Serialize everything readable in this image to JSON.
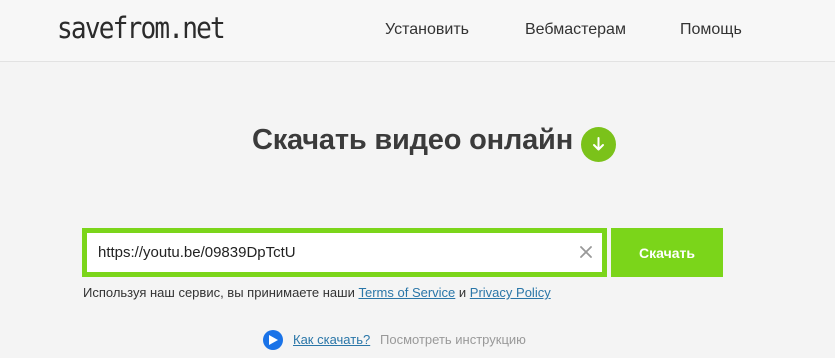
{
  "header": {
    "logo": "savefrom.net",
    "nav": [
      "Установить",
      "Вебмастерам",
      "Помощь"
    ]
  },
  "hero": {
    "title": "Скачать видео онлайн",
    "icon": "download-arrow-icon"
  },
  "form": {
    "url_value": "https://youtu.be/09839DpTctU",
    "submit_label": "Скачать",
    "clear_icon": "close-icon"
  },
  "terms": {
    "prefix": "Используя наш сервис, вы принимаете наши ",
    "tos_label": "Terms of Service",
    "and": " и ",
    "privacy_label": "Privacy Policy"
  },
  "howto": {
    "link_label": "Как скачать?",
    "hint": "Посмотреть инструкцию",
    "icon": "play-icon"
  },
  "colors": {
    "accent_green": "#7bd51a",
    "link_blue": "#2a76a8",
    "play_blue": "#1a73e8"
  }
}
